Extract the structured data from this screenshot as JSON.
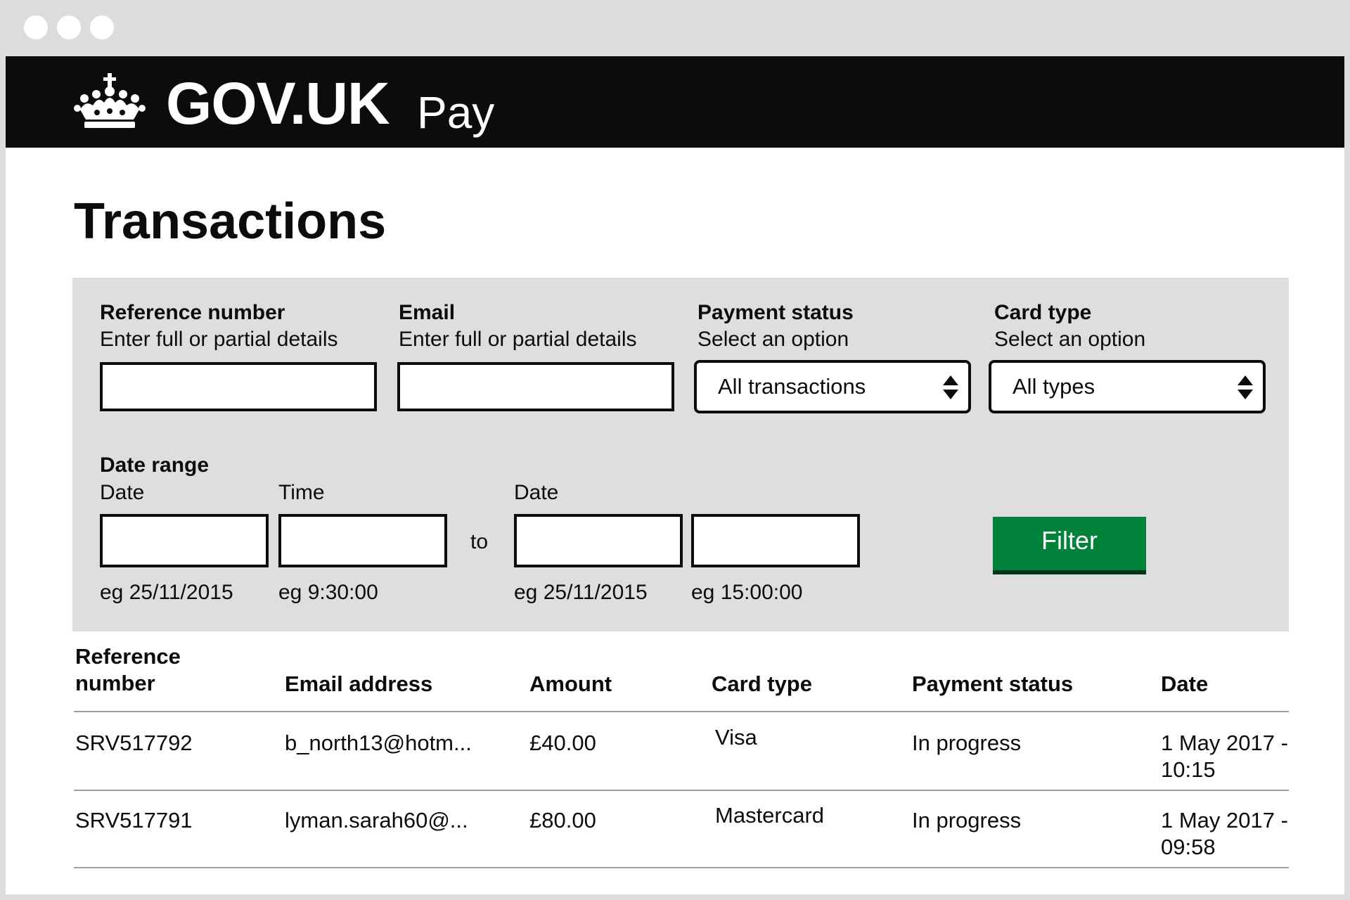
{
  "header": {
    "logo_text": "GOV.UK",
    "service_name": "Pay"
  },
  "page": {
    "title": "Transactions"
  },
  "filters": {
    "reference": {
      "label": "Reference number",
      "hint": "Enter full or partial details",
      "value": ""
    },
    "email": {
      "label": "Email",
      "hint": "Enter full or partial details",
      "value": ""
    },
    "payment_status": {
      "label": "Payment status",
      "hint": "Select an option",
      "selected": "All transactions"
    },
    "card_type": {
      "label": "Card type",
      "hint": "Select an option",
      "selected": "All types"
    },
    "date_range": {
      "label": "Date range",
      "from_date_label": "Date",
      "from_time_label": "Time",
      "to_label": "to",
      "to_date_label": "Date",
      "from_date_hint": "eg 25/11/2015",
      "from_time_hint": "eg 9:30:00",
      "to_date_hint": "eg 25/11/2015",
      "to_time_hint": "eg 15:00:00"
    },
    "button_label": "Filter"
  },
  "table": {
    "headers": [
      "Reference\nnumber",
      "Email address",
      "Amount",
      "Card type",
      "Payment status",
      "Date"
    ],
    "rows": [
      {
        "reference": "SRV517792",
        "email": "b_north13@hotm...",
        "amount": "£40.00",
        "card_type": "Visa",
        "status": "In progress",
        "date": "1 May 2017 -\n10:15"
      },
      {
        "reference": "SRV517791",
        "email": "lyman.sarah60@...",
        "amount": "£80.00",
        "card_type": "Mastercard",
        "status": "In progress",
        "date": "1 May 2017 -\n09:58"
      }
    ]
  },
  "colors": {
    "header_bg": "#0b0c0c",
    "filter_button": "#00823b",
    "panel_bg": "#dedede"
  }
}
